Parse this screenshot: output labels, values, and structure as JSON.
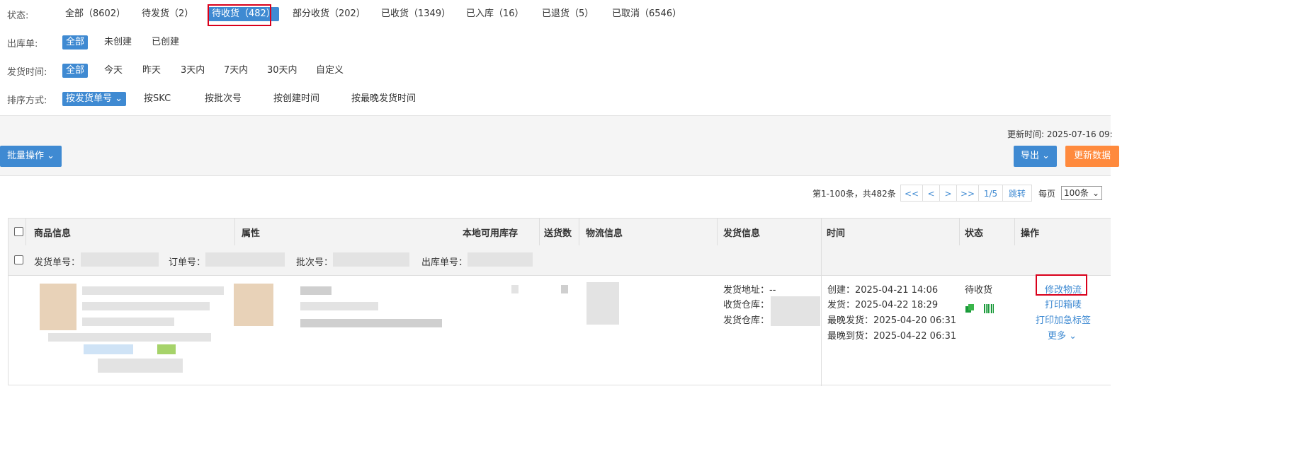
{
  "filters": {
    "status": {
      "label": "状态:",
      "options": [
        "全部（8602）",
        "待发货（2）",
        "待收货（482）",
        "部分收货（202）",
        "已收货（1349）",
        "已入库（16）",
        "已退货（5）",
        "已取消（6546）"
      ],
      "selected_index": 2
    },
    "outbound": {
      "label": "出库单:",
      "options": [
        "全部",
        "未创建",
        "已创建"
      ]
    },
    "ship_time": {
      "label": "发货时间:",
      "options": [
        "全部",
        "今天",
        "昨天",
        "3天内",
        "7天内",
        "30天内",
        "自定义"
      ]
    },
    "sort": {
      "label": "排序方式:",
      "options": [
        "按发货单号",
        "按SKC",
        "按批次号",
        "按创建时间",
        "按最晚发货时间"
      ]
    }
  },
  "toolbar": {
    "update_time": "更新时间: 2025-07-16 09:",
    "batch_label": "批量操作",
    "export_label": "导出",
    "refresh_label": "更新数据"
  },
  "pagination": {
    "summary": "第1-100条，共482条",
    "first": "<<",
    "prev": "<",
    "next": ">",
    "last": ">>",
    "page": "1/5",
    "jump": "跳转",
    "per_page_label": "每页",
    "per_page_value": "100条"
  },
  "table": {
    "headers": [
      "商品信息",
      "属性",
      "本地可用库存",
      "送货数",
      "物流信息",
      "发货信息",
      "时间",
      "状态",
      "操作"
    ],
    "group": {
      "ship_no_label": "发货单号：",
      "order_no_label": "订单号：",
      "batch_no_label": "批次号：",
      "outbound_no_label": "出库单号："
    },
    "row": {
      "ship_info": [
        "发货地址：--",
        "收货仓库：",
        "发货仓库："
      ],
      "times": [
        "创建：2025-04-21 14:06",
        "发货：2025-04-22 18:29",
        "最晚发货：2025-04-20 06:31",
        "最晚到货：2025-04-22 06:31"
      ],
      "status": "待收货",
      "actions": [
        "修改物流",
        "打印箱唛",
        "打印加急标签",
        "更多"
      ]
    }
  },
  "colors": {
    "accent": "#3f8ad2",
    "highlight": "#d9001b",
    "orange": "#ff8a3d"
  }
}
